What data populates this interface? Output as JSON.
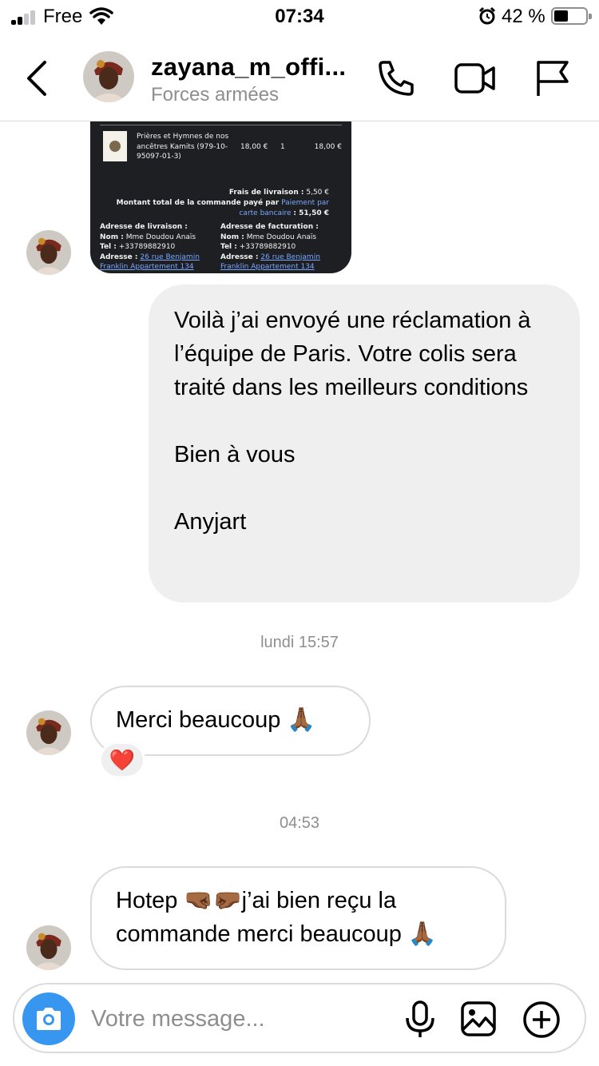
{
  "status_bar": {
    "carrier": "Free",
    "time": "07:34",
    "battery": "42 %",
    "battery_level": 0.42
  },
  "header": {
    "username": "zayana_m_offi...",
    "subtitle": "Forces armées",
    "icons": [
      "back-icon",
      "phone-icon",
      "video-call-icon",
      "flag-icon"
    ]
  },
  "receipt": {
    "item_name": "Prières et Hymnes de nos ancêtres Kamits (979-10-95097-01-3)",
    "item_price": "18,00 €",
    "item_qty": "1",
    "item_total": "18,00 €",
    "shipping_label": "Frais de livraison :",
    "shipping_value": "5,50 €",
    "total_label": "Montant total de la commande payé par",
    "payment_method": "Paiement par carte bancaire",
    "total_value": ": 51,50 €",
    "delivery": {
      "heading": "Adresse de livraison :",
      "name_label": "Nom :",
      "name": "Mme Doudou Anaïs",
      "tel_label": "Tel :",
      "tel": "+33789882910",
      "address_label": "Adresse :",
      "address": "26 rue Benjamin Franklin Appartement 134"
    },
    "billing": {
      "heading": "Adresse de facturation :",
      "name_label": "Nom :",
      "name": "Mme Doudou Anaïs",
      "tel_label": "Tel :",
      "tel": "+33789882910",
      "address_label": "Adresse :",
      "address": "26 rue Benjamin Franklin Appartement 134"
    }
  },
  "messages": {
    "outgoing_1": "Voilà j’ai envoyé une réclamation à l’équipe de Paris. Votre colis sera traité dans les meilleurs conditions\n\nBien à vous\n\nAnyjart",
    "timestamp_1": "lundi 15:57",
    "incoming_1": "Merci beaucoup 🙏🏾",
    "reaction_1": "❤️",
    "timestamp_2": "04:53",
    "incoming_2": "Hotep 🤜🏾🤛🏾j’ai bien reçu la\ncommande merci beaucoup 🙏🏾"
  },
  "composer": {
    "placeholder": "Votre message...",
    "icons": [
      "camera-icon",
      "microphone-icon",
      "gallery-icon",
      "add-icon"
    ]
  },
  "colors": {
    "accent": "#3797f0",
    "outgoing_bubble": "#efefef",
    "border": "#dbdbdb",
    "secondary_text": "#8e8e8e"
  }
}
